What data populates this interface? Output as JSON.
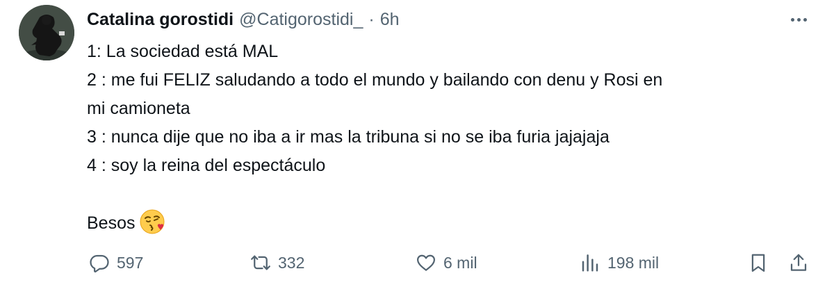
{
  "tweet": {
    "author_name": "Catalina gorostidi",
    "handle": "@Catigorostidi_",
    "separator": "·",
    "time": "6h",
    "lines": [
      "1:   La sociedad está MAL",
      "2 : me fui FELIZ saludando a todo el mundo y bailando con denu y Rosi en",
      "mi camioneta",
      "3 : nunca dije que no iba a ir mas la tribuna si no se iba furia jajajaja",
      "4 : soy la reina del espectáculo"
    ],
    "closing": "Besos",
    "closing_emoji": "kissing-face-emoji"
  },
  "actions": {
    "replies": "597",
    "retweets": "332",
    "likes": "6 mil",
    "views": "198 mil"
  },
  "icons": {
    "more": "more-dots-icon",
    "reply": "reply-icon",
    "retweet": "retweet-icon",
    "like": "heart-icon",
    "views": "views-icon",
    "bookmark": "bookmark-icon",
    "share": "share-icon"
  },
  "colors": {
    "text": "#0f1419",
    "secondary": "#536471",
    "background": "#ffffff"
  }
}
